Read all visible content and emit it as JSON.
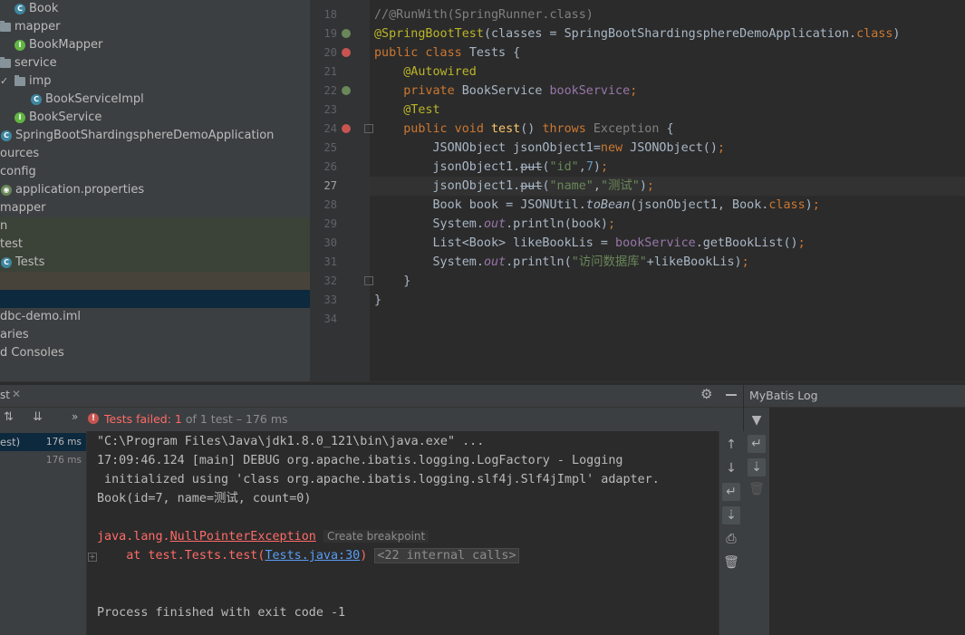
{
  "tree": [
    {
      "label": "Book",
      "icon": "class-icon",
      "glyph": "C"
    },
    {
      "label": "mapper",
      "icon": "folder-icon"
    },
    {
      "label": "BookMapper",
      "icon": "interface-icon",
      "glyph": "I"
    },
    {
      "label": "service",
      "icon": "folder-icon"
    },
    {
      "label": "imp",
      "icon": "folder-icon",
      "chevron": "✓"
    },
    {
      "label": "BookServiceImpl",
      "icon": "class-icon",
      "glyph": "C"
    },
    {
      "label": "BookService",
      "icon": "interface-icon",
      "glyph": "I"
    },
    {
      "label": "SpringBootShardingsphereDemoApplication",
      "icon": "class-icon",
      "glyph": "C"
    },
    {
      "label": "ources"
    },
    {
      "label": "config"
    },
    {
      "label": "application.properties",
      "icon": "spring-icon",
      "glyph": "◉"
    },
    {
      "label": "mapper"
    },
    {
      "label": "n"
    },
    {
      "label": "test"
    },
    {
      "label": "Tests",
      "icon": "class-icon",
      "glyph": "C"
    },
    {
      "label": ""
    },
    {
      "label": ""
    },
    {
      "label": "dbc-demo.iml"
    },
    {
      "label": "aries"
    },
    {
      "label": "d Consoles"
    }
  ],
  "editor": {
    "line_numbers": [
      "18",
      "19",
      "20",
      "21",
      "22",
      "23",
      "24",
      "25",
      "26",
      "27",
      "28",
      "29",
      "30",
      "31",
      "32",
      "33",
      "34"
    ],
    "code": [
      {
        "parts": [
          {
            "t": "//@RunWith(SpringRunner.class)",
            "c": "cm"
          }
        ]
      },
      {
        "parts": [
          {
            "t": "@SpringBootTest",
            "c": "an"
          },
          {
            "t": "(classes = SpringBootShardingsphereDemoApplication."
          },
          {
            "t": "class",
            "c": "kw"
          },
          {
            "t": ")"
          }
        ]
      },
      {
        "parts": [
          {
            "t": "public class ",
            "c": "kw"
          },
          {
            "t": "Tests {"
          }
        ]
      },
      {
        "parts": [
          {
            "t": "    "
          },
          {
            "t": "@Autowired",
            "c": "an"
          }
        ]
      },
      {
        "parts": [
          {
            "t": "    "
          },
          {
            "t": "private ",
            "c": "kw"
          },
          {
            "t": "BookService "
          },
          {
            "t": "bookService",
            "c": "fd"
          },
          {
            "t": ";",
            "c": "kw"
          }
        ]
      },
      {
        "parts": [
          {
            "t": "    "
          },
          {
            "t": "@Test",
            "c": "an"
          }
        ]
      },
      {
        "parts": [
          {
            "t": "    "
          },
          {
            "t": "public void ",
            "c": "kw"
          },
          {
            "t": "test",
            "c": "mt"
          },
          {
            "t": "() "
          },
          {
            "t": "throws ",
            "c": "kw"
          },
          {
            "t": "Exception",
            "c": "cm"
          },
          {
            "t": " {"
          }
        ]
      },
      {
        "parts": [
          {
            "t": "        JSONObject jsonObject1="
          },
          {
            "t": "new ",
            "c": "kw"
          },
          {
            "t": "JSONObject()"
          },
          {
            "t": ";",
            "c": "kw"
          }
        ]
      },
      {
        "parts": [
          {
            "t": "        jsonObject1.put("
          },
          {
            "t": "\"id\"",
            "c": "st"
          },
          {
            "t": ","
          },
          {
            "t": "7",
            "c": "nm"
          },
          {
            "t": ")"
          },
          {
            "t": ";",
            "c": "kw"
          }
        ]
      },
      {
        "parts": [
          {
            "t": "        jsonObject1.put("
          },
          {
            "t": "\"name\"",
            "c": "st"
          },
          {
            "t": ","
          },
          {
            "t": "\"测试\"",
            "c": "st"
          },
          {
            "t": ")"
          },
          {
            "t": ";",
            "c": "kw"
          }
        ]
      },
      {
        "parts": [
          {
            "t": "        Book book = JSONUtil."
          },
          {
            "t": "toBean",
            "c": "it"
          },
          {
            "t": "(jsonObject1, Book."
          },
          {
            "t": "class",
            "c": "kw"
          },
          {
            "t": ")"
          },
          {
            "t": ";",
            "c": "kw"
          }
        ]
      },
      {
        "parts": [
          {
            "t": "        System."
          },
          {
            "t": "out",
            "c": "fd it"
          },
          {
            "t": ".println(book)"
          },
          {
            "t": ";",
            "c": "kw"
          }
        ]
      },
      {
        "parts": [
          {
            "t": "        List<Book> likeBookLis = "
          },
          {
            "t": "bookService",
            "c": "fd"
          },
          {
            "t": ".getBookList()"
          },
          {
            "t": ";",
            "c": "kw"
          }
        ]
      },
      {
        "parts": [
          {
            "t": "        System."
          },
          {
            "t": "out",
            "c": "fd it"
          },
          {
            "t": ".println("
          },
          {
            "t": "\"访问数据库\"",
            "c": "st"
          },
          {
            "t": "+likeBookLis)"
          },
          {
            "t": ";",
            "c": "kw"
          }
        ]
      },
      {
        "parts": [
          {
            "t": "    }"
          }
        ]
      },
      {
        "parts": [
          {
            "t": "}"
          }
        ]
      },
      {
        "parts": [
          {
            "t": ""
          }
        ]
      }
    ]
  },
  "run": {
    "tab_label": "st",
    "status_failed": "Tests failed: 1",
    "status_rest": " of 1 test – 176 ms",
    "mybatis_title": "MyBatis Log",
    "tests": [
      {
        "name": "est)",
        "time": "176 ms"
      },
      {
        "name": "",
        "time": "176 ms"
      }
    ]
  },
  "console": {
    "line1": "\"C:\\Program Files\\Java\\jdk1.8.0_121\\bin\\java.exe\" ...",
    "line2": "17:09:46.124 [main] DEBUG org.apache.ibatis.logging.LogFactory - Logging",
    "line3": " initialized using 'class org.apache.ibatis.logging.slf4j.Slf4jImpl' adapter.",
    "line4": "Book(id=7, name=测试, count=0)",
    "exc_prefix": "java.lang.",
    "exc_name": "NullPointerException",
    "create_bp": "Create breakpoint",
    "at_text": "    at test.Tests.test(",
    "at_link": "Tests.java:30",
    "at_close": ")",
    "internal_calls": "<22 internal calls>",
    "finished": "Process finished with exit code -1"
  },
  "colors": {
    "accent": "#ff6b68",
    "link": "#589df6",
    "bg": "#2b2b2b"
  }
}
